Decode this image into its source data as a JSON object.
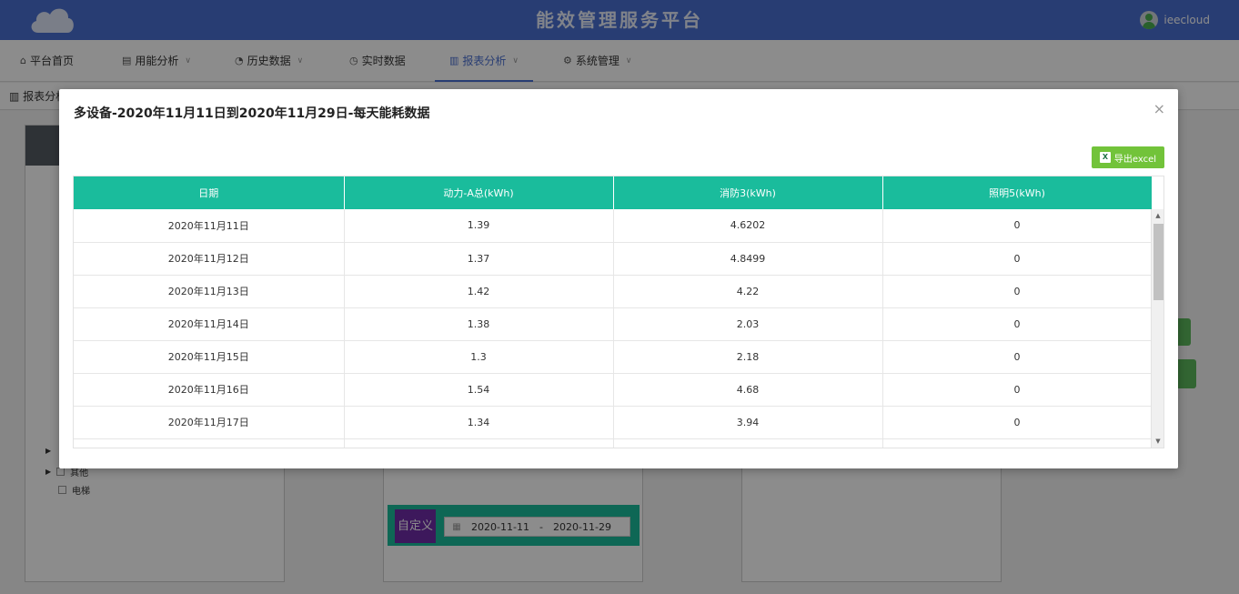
{
  "header": {
    "title": "能效管理服务平台",
    "username": "ieecloud"
  },
  "nav": {
    "items": [
      {
        "label": "平台首页",
        "icon": "home-icon",
        "has_dropdown": false
      },
      {
        "label": "用能分析",
        "icon": "calendar-icon",
        "has_dropdown": true
      },
      {
        "label": "历史数据",
        "icon": "gauge-icon",
        "has_dropdown": true
      },
      {
        "label": "实时数据",
        "icon": "clock-icon",
        "has_dropdown": false
      },
      {
        "label": "报表分析",
        "icon": "bar-chart-icon",
        "has_dropdown": true,
        "active": true
      },
      {
        "label": "系统管理",
        "icon": "gear-icon",
        "has_dropdown": true
      }
    ]
  },
  "breadcrumb": {
    "label": "报表分析"
  },
  "background": {
    "tree_items": [
      "其他",
      "电梯"
    ],
    "custom_button": "自定义",
    "date_start": "2020-11-11",
    "date_sep": "-",
    "date_end": "2020-11-29"
  },
  "modal": {
    "title": "多设备-2020年11月11日到2020年11月29日-每天能耗数据",
    "close": "×",
    "export_label": "导出excel",
    "columns": [
      "日期",
      "动力-A总(kWh)",
      "消防3(kWh)",
      "照明5(kWh)"
    ],
    "rows": [
      [
        "2020年11月11日",
        "1.39",
        "4.6202",
        "0"
      ],
      [
        "2020年11月12日",
        "1.37",
        "4.8499",
        "0"
      ],
      [
        "2020年11月13日",
        "1.42",
        "4.22",
        "0"
      ],
      [
        "2020年11月14日",
        "1.38",
        "2.03",
        "0"
      ],
      [
        "2020年11月15日",
        "1.3",
        "2.18",
        "0"
      ],
      [
        "2020年11月16日",
        "1.54",
        "4.68",
        "0"
      ],
      [
        "2020年11月17日",
        "1.34",
        "3.94",
        "0"
      ]
    ]
  },
  "colors": {
    "header": "#4a6fd1",
    "table_header": "#1abc9c",
    "export_button": "#72c33a",
    "custom_button": "#6f2da8"
  }
}
